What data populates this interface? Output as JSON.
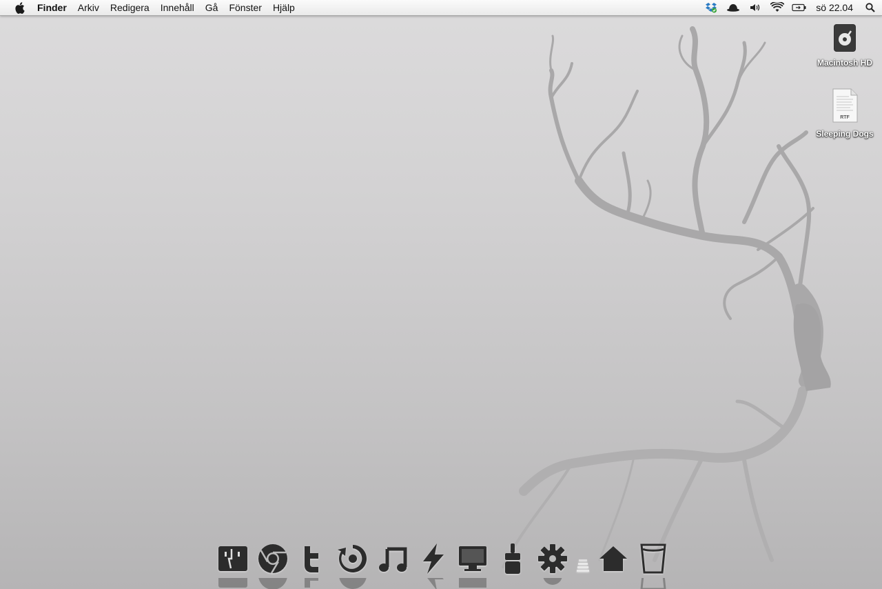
{
  "menubar": {
    "apple_icon": "apple-icon",
    "app_name": "Finder",
    "menus": [
      "Arkiv",
      "Redigera",
      "Innehåll",
      "Gå",
      "Fönster",
      "Hjälp"
    ],
    "status_icons": [
      "dropbox-icon",
      "bowler-hat-icon",
      "volume-icon",
      "wifi-icon",
      "battery-icon"
    ],
    "clock": "sö 22.04",
    "spotlight_icon": "spotlight-search-icon"
  },
  "desktop": {
    "icons": [
      {
        "label": "Macintosh HD",
        "icon": "hard-drive-icon"
      },
      {
        "label": "Sleeping Dogs",
        "icon": "rtf-document-icon",
        "badge": "RTF"
      }
    ]
  },
  "dock": {
    "items": [
      "finder-icon",
      "chrome-icon",
      "twitter-icon",
      "app-store-icon",
      "itunes-icon",
      "reeder-icon",
      "display-icon",
      "brush-icon",
      "settings-icon",
      "separator",
      "home-icon",
      "trash-icon"
    ]
  },
  "colors": {
    "desktop_top": "#dcdbdc",
    "desktop_bottom": "#b5b4b5",
    "tree": "#a9a8a9",
    "dock_icon": "#2c2c2c"
  }
}
